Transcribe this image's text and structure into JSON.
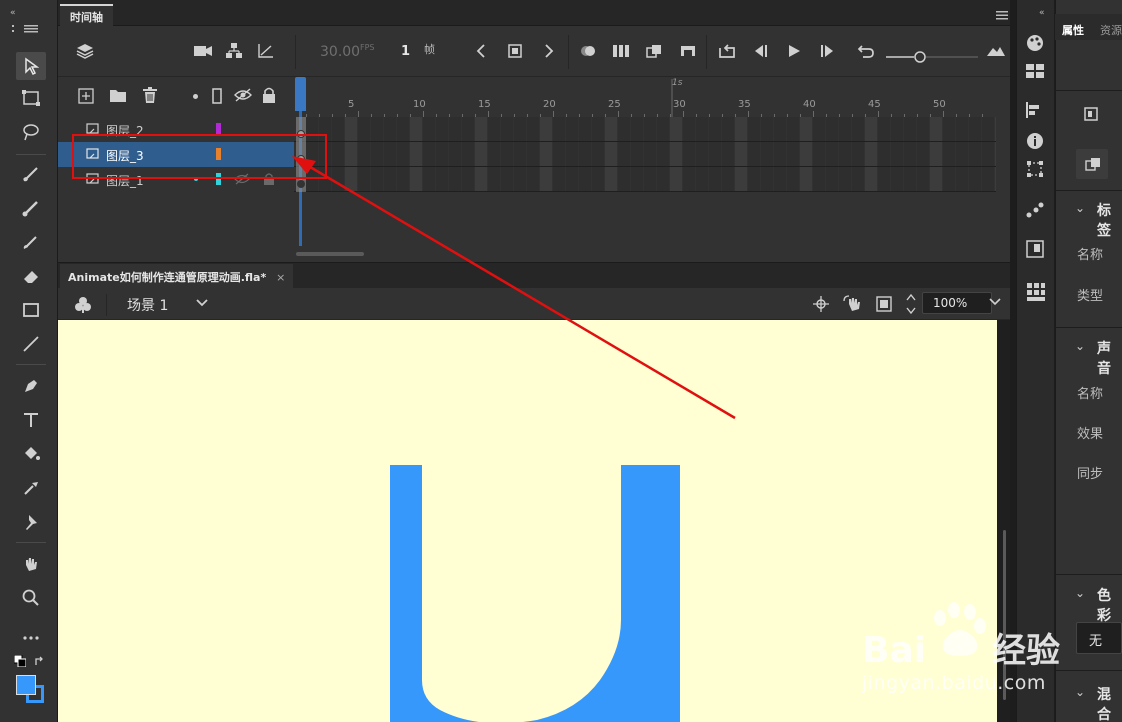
{
  "timeline": {
    "tab_title": "时间轴",
    "fps_value": "30.00",
    "fps_unit": "FPS",
    "frame_value": "1",
    "frame_unit": "帧",
    "ruler_marks": [
      "5",
      "10",
      "15",
      "20",
      "25",
      "30",
      "35",
      "40",
      "45",
      "50"
    ],
    "second_mark": "1s",
    "layers": [
      {
        "name": "图层_2",
        "color": "#b12ad6",
        "selected": false
      },
      {
        "name": "图层_3",
        "color": "#e8812b",
        "selected": true
      },
      {
        "name": "图层_1",
        "color": "#2ed3de",
        "selected": false
      }
    ]
  },
  "document": {
    "tab_title": "Animate如何制作连通管原理动画.fla*",
    "close_glyph": "×",
    "scene_label": "场景 1",
    "zoom": "100%"
  },
  "stage": {
    "background": "#ffffd3",
    "shape_color": "#3798fb"
  },
  "properties": {
    "tab_properties": "属性",
    "tab_assets": "资源",
    "section_label": "标签",
    "label_name": "名称",
    "label_type": "类型",
    "section_sound": "声音",
    "sound_name": "名称",
    "sound_effect": "效果",
    "sound_sync": "同步",
    "section_color": "色彩",
    "color_value": "无",
    "section_blend": "混合"
  },
  "watermark": {
    "brand": "Bai 经验",
    "url": "jingyan.baidu.com"
  },
  "annotation": {
    "color": "#e01010"
  }
}
